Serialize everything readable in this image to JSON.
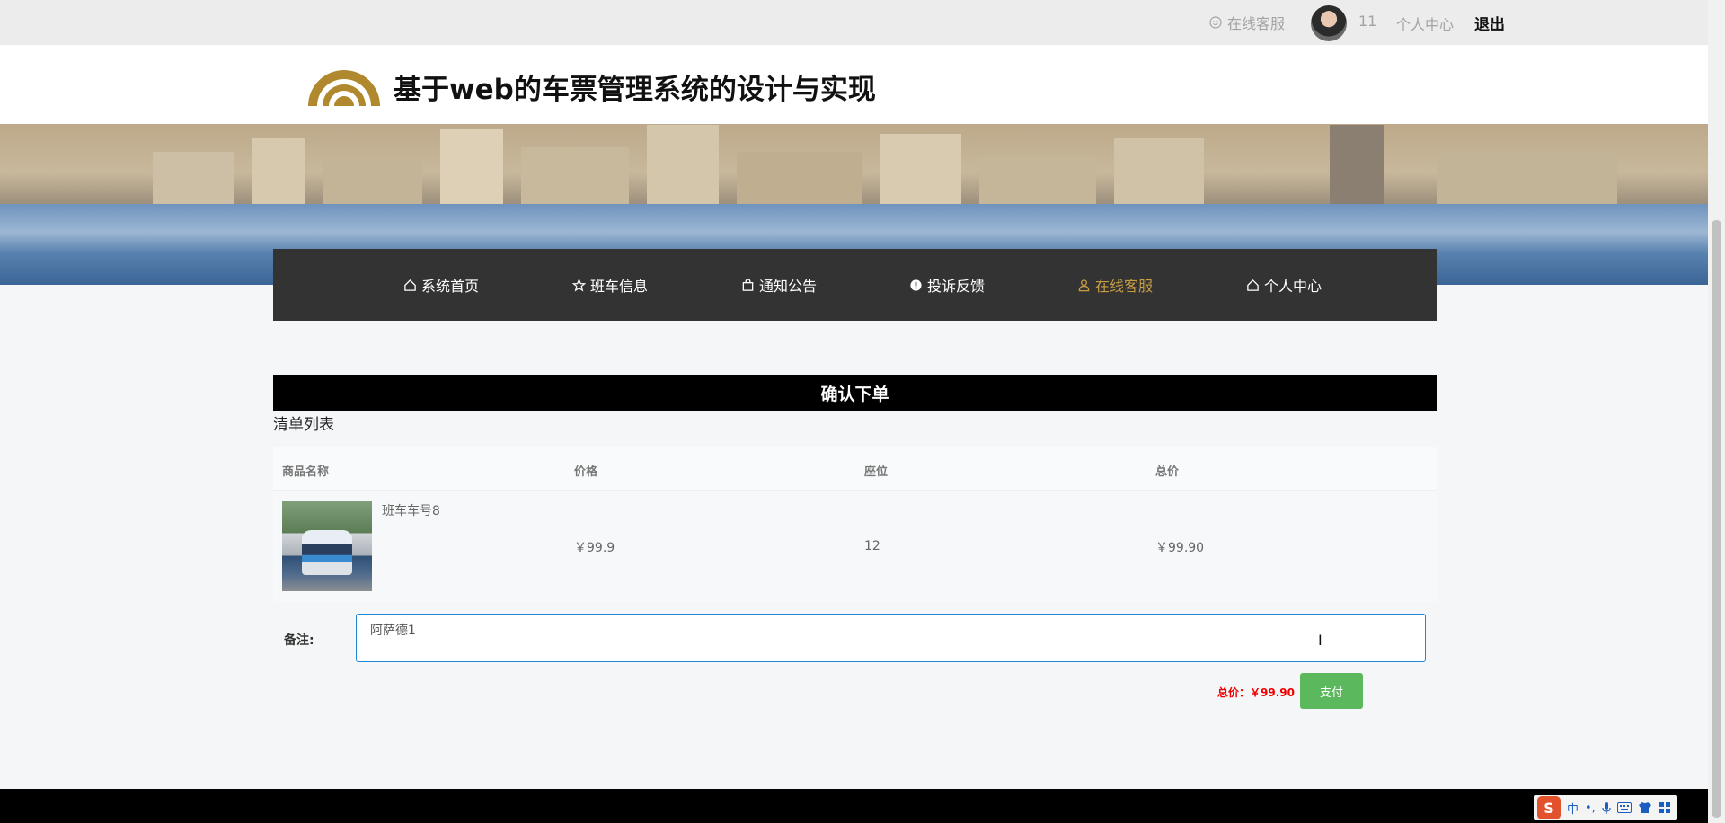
{
  "topbar": {
    "service_label": "在线客服",
    "user_id": "11",
    "personal_center": "个人中心",
    "logout": "退出"
  },
  "header": {
    "title": "基于web的车票管理系统的设计与实现"
  },
  "nav": {
    "items": [
      {
        "label": "系统首页",
        "icon": "home-icon"
      },
      {
        "label": "班车信息",
        "icon": "star-icon"
      },
      {
        "label": "通知公告",
        "icon": "bag-icon"
      },
      {
        "label": "投诉反馈",
        "icon": "alert-icon"
      },
      {
        "label": "在线客服",
        "icon": "user-icon",
        "active": true
      },
      {
        "label": "个人中心",
        "icon": "home-icon"
      }
    ]
  },
  "order": {
    "heading": "确认下单",
    "list_title": "清单列表",
    "columns": [
      "商品名称",
      "价格",
      "座位",
      "总价"
    ],
    "rows": [
      {
        "name": "班车车号8",
        "price": "￥99.9",
        "seat": "12",
        "total": "￥99.90"
      }
    ],
    "remark_label": "备注:",
    "remark_value": "阿萨德1",
    "total_label": "总价：￥99.90",
    "pay_label": "支付"
  },
  "ime": {
    "lang": "中",
    "punct": "•,"
  },
  "colors": {
    "nav_bg": "#333333",
    "nav_active": "#c89e45",
    "pay_button": "#5cb85c",
    "total_price": "#e00000"
  }
}
